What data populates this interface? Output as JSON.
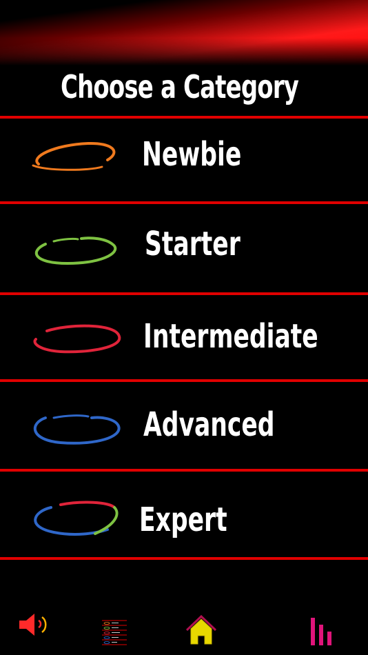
{
  "header": {
    "title": "Choose a Category"
  },
  "categories": [
    {
      "label": "Newbie",
      "icon": "orange-swirl-icon",
      "color": "#f07a1e"
    },
    {
      "label": "Starter",
      "icon": "green-swirl-icon",
      "color": "#7ec242"
    },
    {
      "label": "Intermediate",
      "icon": "red-swirl-icon",
      "color": "#e0243a"
    },
    {
      "label": "Advanced",
      "icon": "blue-swirl-icon",
      "color": "#2f67c9"
    },
    {
      "label": "Expert",
      "icon": "multicolor-swirl-icon",
      "colors": [
        "#2f67c9",
        "#e0243a",
        "#7ec242"
      ]
    }
  ],
  "bottom_bar": {
    "buttons": [
      {
        "icon": "speaker-icon",
        "color": "#ff2a2a"
      },
      {
        "icon": "category-list-thumbnail-icon"
      },
      {
        "icon": "home-icon",
        "color": "#e8d800"
      },
      {
        "icon": "leaderboard-bars-icon",
        "color": "#e0147a"
      }
    ]
  },
  "theme": {
    "accent": "#e00000",
    "background": "#000000",
    "text": "#ffffff"
  }
}
